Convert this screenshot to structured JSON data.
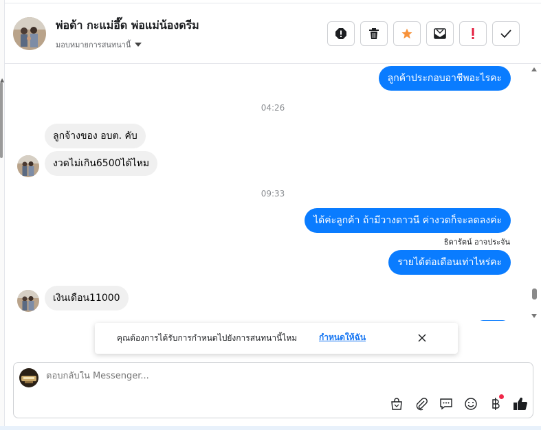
{
  "header": {
    "contact_name": "พ่อด้า กะแม่อึ๊ด พ่อแม่น้องดรีม",
    "assign_label": "มอบหมายการสนทนานี้",
    "actions": [
      {
        "name": "spam-icon"
      },
      {
        "name": "trash-icon"
      },
      {
        "name": "star-icon"
      },
      {
        "name": "mark-unread-icon"
      },
      {
        "name": "follow-up-icon"
      },
      {
        "name": "done-check-icon"
      }
    ]
  },
  "thread": {
    "msg1": "ลูกค้าประกอบอาชีพอะไรคะ",
    "time1": "04:26",
    "msg2": "ลูกจ้างของ อบต. คับ",
    "msg3": "งวดไม่เกิน6500ได้ไหม",
    "time2": "09:33",
    "msg4": "ได้ค่ะลูกค้า ถ้ามีวางดาวนี ค่างวดก็จะลดลงค่ะ",
    "sender_label": "ธิดารัตน์ อาจประจัน",
    "msg5": "รายได้ต่อเดือนเท่าไหร่คะ",
    "msg6": "เงินเดือน11000"
  },
  "banner": {
    "text": "คุณต้องการได้รับการกำหนดไปยังการสนทนานี้ไหม",
    "link": "กำหนดให้ฉัน"
  },
  "composer": {
    "placeholder": "ตอบกลับใน Messenger...",
    "tools": [
      "shopping-bag-icon",
      "attachment-icon",
      "saved-reply-icon",
      "emoji-icon",
      "baht-payment-icon",
      "thumbs-up-icon"
    ]
  },
  "colors": {
    "outgoing_bubble": "#0a7cff",
    "incoming_bubble": "#f0f0f0",
    "link": "#1877f2",
    "star": "#f7923a",
    "alert_red": "#e41e3f"
  }
}
